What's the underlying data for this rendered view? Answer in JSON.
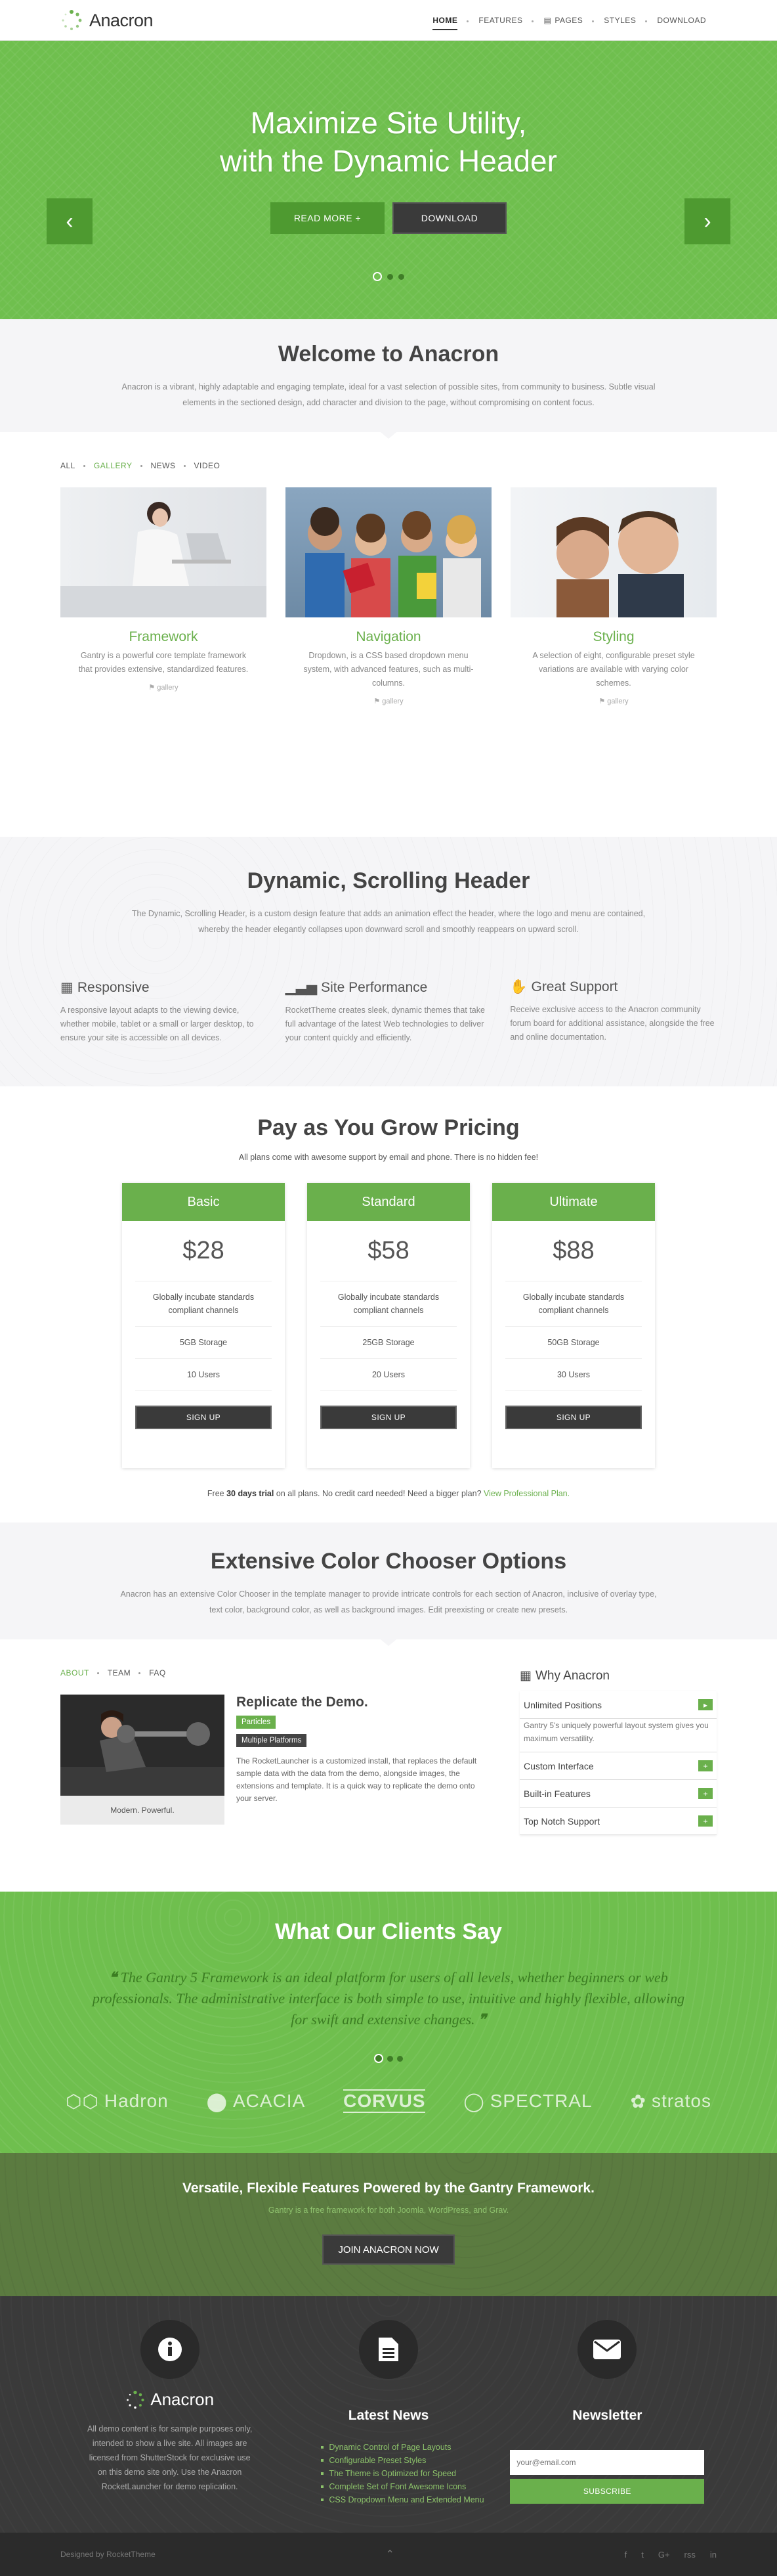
{
  "nav": {
    "brand": "Anacron",
    "items": [
      {
        "label": "HOME",
        "active": true
      },
      {
        "label": "FEATURES"
      },
      {
        "label": "PAGES"
      },
      {
        "label": "STYLES"
      },
      {
        "label": "DOWNLOAD"
      }
    ]
  },
  "hero": {
    "title_line1": "Maximize Site Utility,",
    "title_line2": "with the Dynamic Header",
    "read_more": "READ MORE +",
    "download": "DOWNLOAD"
  },
  "welcome": {
    "title": "Welcome to Anacron",
    "text": "Anacron is a vibrant, highly adaptable and engaging template, ideal for a vast selection of possible sites, from community to business. Subtle visual elements in the sectioned design, add character and division to the page, without compromising on content focus."
  },
  "gallery": {
    "tabs": [
      "ALL",
      "GALLERY",
      "NEWS",
      "VIDEO"
    ],
    "cards": [
      {
        "title": "Framework",
        "text": "Gantry is a powerful core template framework that provides extensive, standardized features.",
        "tag": "gallery"
      },
      {
        "title": "Navigation",
        "text": "Dropdown, is a CSS based dropdown menu system, with advanced features, such as multi-columns.",
        "tag": "gallery"
      },
      {
        "title": "Styling",
        "text": "A selection of eight, configurable preset style variations are available with varying color schemes.",
        "tag": "gallery"
      }
    ]
  },
  "dynamic": {
    "title": "Dynamic, Scrolling Header",
    "text": "The Dynamic, Scrolling Header, is a custom design feature that adds an animation effect the header, where the logo and menu are contained, whereby the header elegantly collapses upon downward scroll and smoothly reappears on upward scroll.",
    "features": [
      {
        "title": "Responsive",
        "text": "A responsive layout adapts to the viewing device, whether mobile, tablet or a small or larger desktop, to ensure your site is accessible on all devices."
      },
      {
        "title": "Site Performance",
        "text": "RocketTheme creates sleek, dynamic themes that take full advantage of the latest Web technologies to deliver your content quickly and efficiently."
      },
      {
        "title": "Great Support",
        "text": "Receive exclusive access to the Anacron community forum board for additional assistance, alongside the free and online documentation."
      }
    ]
  },
  "pricing": {
    "title": "Pay as You Grow Pricing",
    "subtitle": "All plans come with awesome support by email and phone. There is no hidden fee!",
    "plans": [
      {
        "name": "Basic",
        "price": "$28",
        "feature": "Globally incubate standards compliant channels",
        "storage": "5GB Storage",
        "users": "10 Users",
        "button": "SIGN UP"
      },
      {
        "name": "Standard",
        "price": "$58",
        "feature": "Globally incubate standards compliant channels",
        "storage": "25GB Storage",
        "users": "20 Users",
        "button": "SIGN UP"
      },
      {
        "name": "Ultimate",
        "price": "$88",
        "feature": "Globally incubate standards compliant channels",
        "storage": "50GB Storage",
        "users": "30 Users",
        "button": "SIGN UP"
      }
    ],
    "foot_pre": "Free ",
    "foot_bold": "30 days trial",
    "foot_mid": " on all plans. No credit card needed! Need a bigger plan? ",
    "foot_link": "View Professional Plan."
  },
  "chooser": {
    "title": "Extensive Color Chooser Options",
    "text": "Anacron has an extensive Color Chooser in the template manager to provide intricate controls for each section of Anacron, inclusive of overlay type, text color, background color, as well as background images. Edit preexisting or create new presets."
  },
  "about": {
    "tabs": [
      "ABOUT",
      "TEAM",
      "FAQ"
    ],
    "caption": "Modern. Powerful.",
    "title": "Replicate the Demo.",
    "badge1": "Particles",
    "badge2": "Multiple Platforms",
    "text": "The RocketLauncher is a customized install, that replaces the default sample data with the data from the demo, alongside images, the extensions and template. It is a quick way to replicate the demo onto your server."
  },
  "why": {
    "title": "Why Anacron",
    "items": [
      {
        "label": "Unlimited Positions",
        "body": "Gantry 5's uniquely powerful layout system gives you maximum versatility."
      },
      {
        "label": "Custom Interface"
      },
      {
        "label": "Built-in Features"
      },
      {
        "label": "Top Notch Support"
      }
    ]
  },
  "clients": {
    "title": "What Our Clients Say",
    "quote": "The Gantry 5 Framework is an ideal platform for users of all levels, whether beginners or web professionals. The administrative interface is both simple to use, intuitive and highly flexible, allowing for swift and extensive changes.",
    "logos": [
      "Hadron",
      "ACACIA",
      "CORVUS",
      "SPECTRAL",
      "stratos"
    ]
  },
  "cta": {
    "title": "Versatile, Flexible Features Powered by the Gantry Framework.",
    "subtitle": "Gantry is a free framework for both Joomla, WordPress, and Grav.",
    "button": "JOIN ANACRON NOW"
  },
  "footer": {
    "brand": "Anacron",
    "about": "All demo content is for sample purposes only, intended to show a live site. All images are licensed from ShutterStock for exclusive use on this demo site only. Use the Anacron RocketLauncher for demo replication.",
    "news_title": "Latest News",
    "news": [
      "Dynamic Control of Page Layouts",
      "Configurable Preset Styles",
      "The Theme is Optimized for Speed",
      "Complete Set of Font Awesome Icons",
      "CSS Dropdown Menu and Extended Menu"
    ],
    "newsletter_title": "Newsletter",
    "email_placeholder": "your@email.com",
    "subscribe": "SUBSCRIBE"
  },
  "copyright": {
    "text": "Designed by RocketTheme",
    "socials": [
      "f",
      "t",
      "G+",
      "rss",
      "in"
    ]
  }
}
